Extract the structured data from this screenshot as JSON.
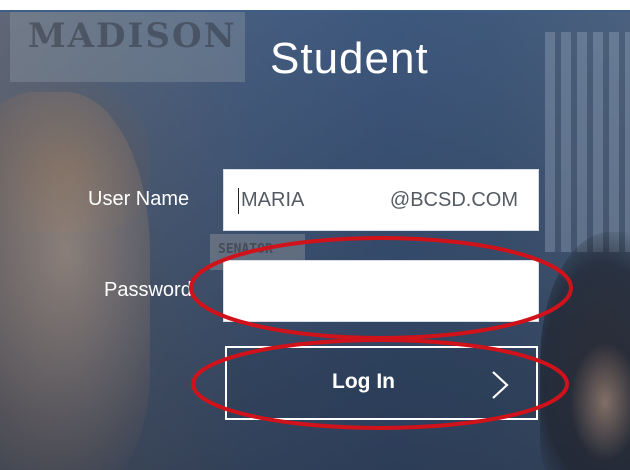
{
  "background": {
    "banner_text": "MADISON",
    "card_text": "SENATOR"
  },
  "header": {
    "title": "Student"
  },
  "form": {
    "username": {
      "label": "User Name",
      "value": "MARIA",
      "domain_suffix": "@BCSD.COM"
    },
    "password": {
      "label": "Password",
      "value": ""
    },
    "login_button": {
      "label": "Log In",
      "icon": "chevron-right-icon"
    }
  },
  "annotations": {
    "color": "#d0121b",
    "highlighted": [
      "password-field",
      "login-button"
    ]
  },
  "colors": {
    "top_border": "#3f5e86",
    "overlay": "#3c5882",
    "text": "#ffffff",
    "field_text": "#555b63"
  }
}
